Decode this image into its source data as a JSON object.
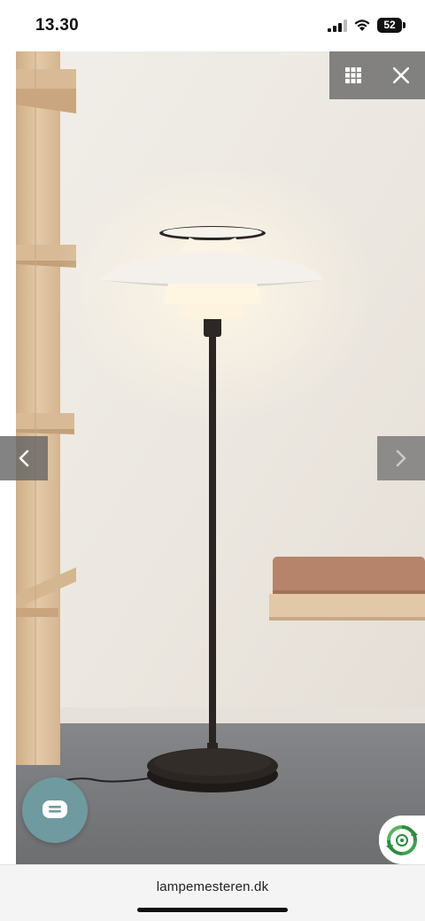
{
  "status_bar": {
    "time": "13.30",
    "battery_level": "52"
  },
  "viewer": {
    "image_description": "floor-lamp-photo",
    "controls": {
      "grid_icon": "grid-icon",
      "close_icon": "close-icon",
      "prev_icon": "chevron-left-icon",
      "next_icon": "chevron-right-icon"
    }
  },
  "chat": {
    "icon": "chat-bubble-icon"
  },
  "badge": {
    "icon": "recycle-badge-icon"
  },
  "browser": {
    "url": "lampemesteren.dk"
  },
  "colors": {
    "wall": "#eeeae4",
    "floor": "#77797a",
    "lamp_shade": "#f3f0ea",
    "lamp_body": "#2a2523",
    "wood": "#dcc2a2",
    "cushion": "#b5846a",
    "chat_button": "#6f9aa0",
    "badge_green": "#2e8b3f"
  }
}
